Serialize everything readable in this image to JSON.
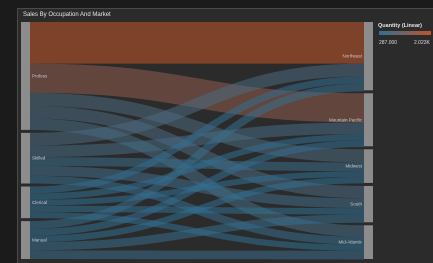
{
  "chart_data": {
    "type": "sankey",
    "title": "Sales By Occupation And Market",
    "legend": {
      "title": "Quantity (Linear)",
      "min_label": "287.000",
      "max_label": "2.023K",
      "min": 287,
      "max": 2023,
      "color_low": "#2f6f93",
      "color_high": "#c2532a",
      "placement": "top-right"
    },
    "left_nodes": [
      {
        "id": "L1",
        "label": "Profess"
      },
      {
        "id": "L2",
        "label": "Skilled"
      },
      {
        "id": "L3",
        "label": "Clerical"
      },
      {
        "id": "L4",
        "label": "Manual"
      }
    ],
    "right_nodes": [
      {
        "id": "R1",
        "label": "Northeast"
      },
      {
        "id": "R2",
        "label": "Mountain Pacific"
      },
      {
        "id": "R3",
        "label": "Midwest"
      },
      {
        "id": "R4",
        "label": "South"
      },
      {
        "id": "R5",
        "label": "Mid-Atlantic"
      }
    ],
    "links": [
      {
        "source": "L1",
        "target": "R1",
        "value": 2023
      },
      {
        "source": "L1",
        "target": "R2",
        "value": 1420
      },
      {
        "source": "L1",
        "target": "R3",
        "value": 640
      },
      {
        "source": "L1",
        "target": "R4",
        "value": 600
      },
      {
        "source": "L1",
        "target": "R5",
        "value": 560
      },
      {
        "source": "L2",
        "target": "R1",
        "value": 620
      },
      {
        "source": "L2",
        "target": "R2",
        "value": 560
      },
      {
        "source": "L2",
        "target": "R3",
        "value": 420
      },
      {
        "source": "L2",
        "target": "R4",
        "value": 480
      },
      {
        "source": "L2",
        "target": "R5",
        "value": 380
      },
      {
        "source": "L3",
        "target": "R1",
        "value": 340
      },
      {
        "source": "L3",
        "target": "R2",
        "value": 300
      },
      {
        "source": "L3",
        "target": "R3",
        "value": 287
      },
      {
        "source": "L3",
        "target": "R4",
        "value": 310
      },
      {
        "source": "L3",
        "target": "R5",
        "value": 300
      },
      {
        "source": "L4",
        "target": "R1",
        "value": 380
      },
      {
        "source": "L4",
        "target": "R2",
        "value": 330
      },
      {
        "source": "L4",
        "target": "R3",
        "value": 310
      },
      {
        "source": "L4",
        "target": "R4",
        "value": 400
      },
      {
        "source": "L4",
        "target": "R5",
        "value": 420
      }
    ]
  }
}
